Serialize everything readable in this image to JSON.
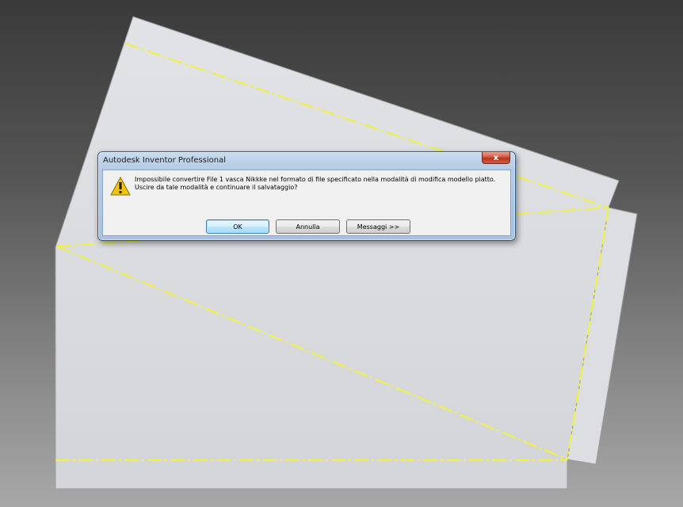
{
  "dialog": {
    "title": "Autodesk Inventor Professional",
    "close_symbol": "x",
    "icon": "warning-icon",
    "message": "Impossibile convertire File 1 vasca Nikkke nel formato di file specificato nella modalità di modifica modello piatto. Uscire da tale modalità e continuare il salvataggio?",
    "buttons": {
      "ok": "OK",
      "cancel": "Annulla",
      "messages": "Messaggi >>"
    }
  },
  "colors": {
    "sheet": "#d9dbde",
    "bend_lines": "#f2f23c",
    "warning": "#f5c400"
  }
}
